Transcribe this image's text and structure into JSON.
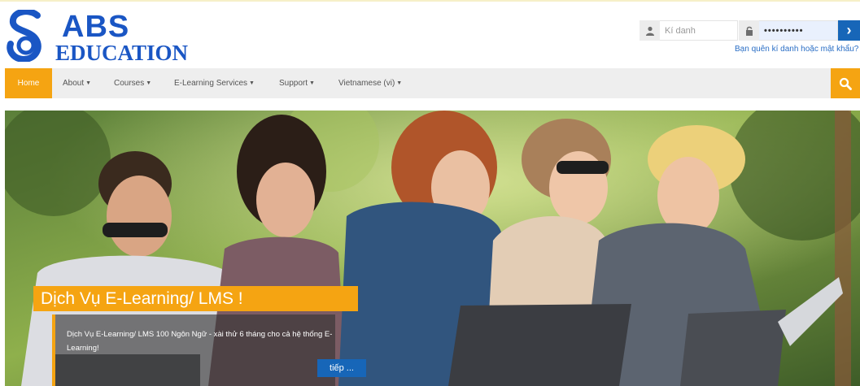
{
  "brand": {
    "line1": "ABS",
    "line2": "EDUCATION",
    "colors": {
      "blue": "#1a56c4",
      "orange": "#f5a412"
    }
  },
  "login": {
    "username_placeholder": "Kí danh",
    "password_value": "••••••••••",
    "submit_icon": "chevron-right-icon",
    "forgot_link": "Bạn quên kí danh hoặc mật khẩu?"
  },
  "nav": {
    "items": [
      {
        "label": "Home",
        "active": true
      },
      {
        "label": "About",
        "dropdown": true
      },
      {
        "label": "Courses",
        "dropdown": true
      },
      {
        "label": "E-Learning Services",
        "dropdown": true
      },
      {
        "label": "Support",
        "dropdown": true
      },
      {
        "label": "Vietnamese (vi)",
        "dropdown": true
      }
    ],
    "search_icon": "search-icon"
  },
  "hero": {
    "title": "Dịch Vụ E-Learning/ LMS !",
    "text": "Dịch Vụ E-Learning/ LMS 100 Ngôn Ngữ - xài thử 6 tháng cho cả hệ thống E-Learning!",
    "button": "tiếp ..."
  }
}
